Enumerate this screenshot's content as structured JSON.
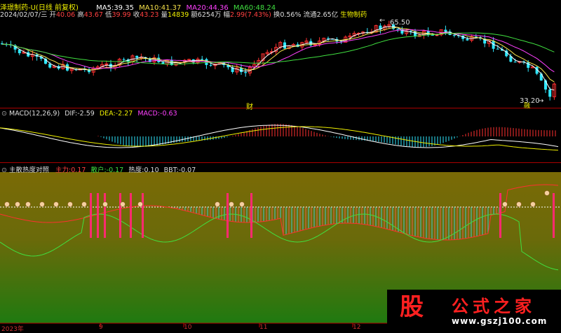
{
  "header": {
    "stock_title": "泽璟制药-U(日线 前复权)",
    "date": "2024/02/07/三",
    "open_label": "开",
    "open": "40.06",
    "high_label": "高",
    "high": "43.67",
    "low_label": "低",
    "low": "39.99",
    "close_label": "收",
    "close": "43.23",
    "volume_label": "量",
    "volume": "14839",
    "amount_label": "额",
    "amount": "6254万",
    "change_label": "幅",
    "change": "2.99(7.43%)",
    "turnover_label": "换",
    "turnover": "0.56%",
    "float_label": "流通",
    "float": "2.65亿",
    "sector": "生物制药"
  },
  "ma_legend": [
    {
      "label": "MA5:",
      "value": "39.35",
      "color": "#ffffff"
    },
    {
      "label": "MA10:",
      "value": "41.37",
      "color": "#f5e04a"
    },
    {
      "label": "MA20:",
      "value": "44.36",
      "color": "#ff40ff"
    },
    {
      "label": "MA60:",
      "value": "48.24",
      "color": "#40e040"
    }
  ],
  "main_chart": {
    "high_marker": "65.50",
    "low_marker": "33.20",
    "event_marker": "财",
    "event_marker2": "融"
  },
  "macd": {
    "title": "MACD(12,26,9)",
    "dif_label": "DIF:",
    "dif": "-2.59",
    "dea_label": "DEA:",
    "dea": "-2.27",
    "macd_label": "MACD:",
    "macd": "-0.63"
  },
  "indicator": {
    "title": "主散热度对照",
    "main_label": "主力:",
    "main": "0.17",
    "retail_label": "散户:",
    "retail": "-0.17",
    "heat_label": "热度:",
    "heat": "0.10",
    "bbt_label": "BBT:",
    "bbt": "-0.07"
  },
  "x_axis": {
    "labels": [
      "2023年",
      "9",
      "10",
      "11",
      "12"
    ]
  },
  "watermark": {
    "logo_char": "股",
    "brand": "公式之家",
    "url": "www.gszj100.com"
  },
  "colors": {
    "up": "#ff3030",
    "down": "#30e8ff",
    "ma5": "#ffffff",
    "ma10": "#f5e04a",
    "ma20": "#ff40ff",
    "ma60": "#40e040",
    "separator": "#aa0000"
  }
}
